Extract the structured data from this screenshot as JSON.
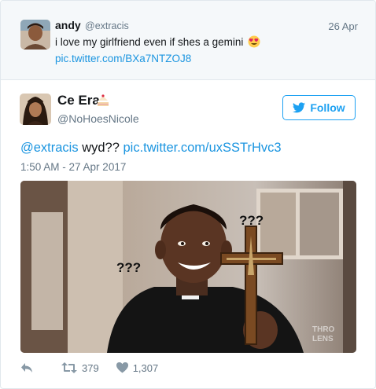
{
  "parent_tweet": {
    "name": "andy",
    "handle": "@extracis",
    "date": "26 Apr",
    "text": "i love my girlfriend even if shes a gemini",
    "emoji": "heart-eyes-emoji",
    "link": "pic.twitter.com/BXa7NTZOJ8"
  },
  "tweet": {
    "name": "Ce Era",
    "name_emoji": "cake-emoji",
    "handle": "@NoHoesNicole",
    "follow_label": "Follow",
    "mention": "@extracis",
    "text": " wyd?? ",
    "url": "pic.twitter.com/uxSSTrHvc3",
    "timestamp": "1:50 AM - 27 Apr 2017",
    "image_labels": {
      "marks_right": "???",
      "marks_left": "???",
      "watermark_top": "THRO",
      "watermark_bottom": "LENS"
    },
    "actions": {
      "retweets": "379",
      "likes": "1,307"
    }
  },
  "colors": {
    "link": "#1b95e0",
    "follow": "#1da1f2",
    "muted": "#657786",
    "parent_bg": "#f5f8fa"
  }
}
